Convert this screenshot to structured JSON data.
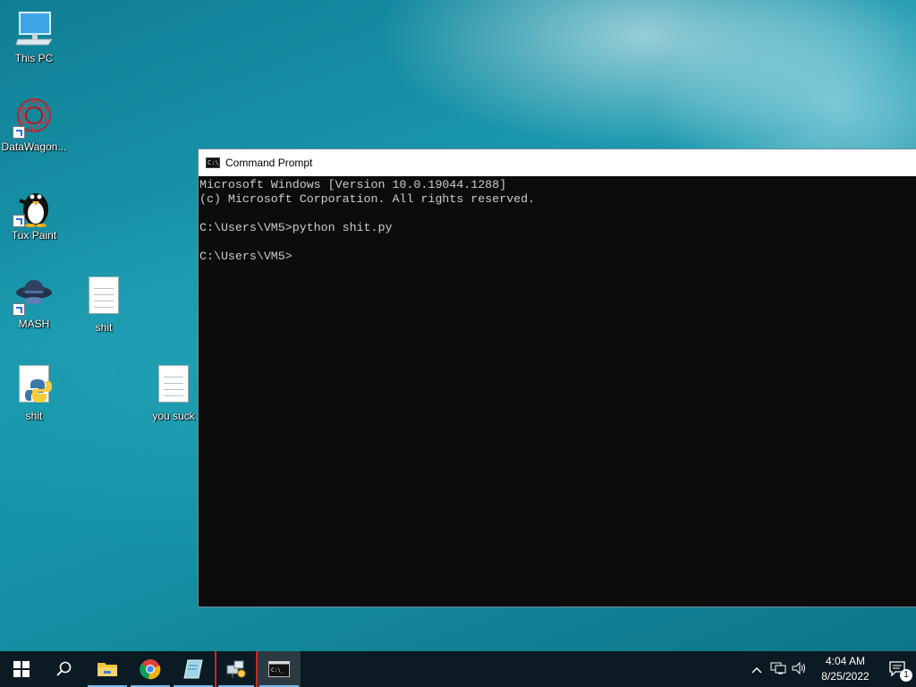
{
  "desktop": {
    "icons": [
      {
        "label": "This PC",
        "icon": "this-pc-icon"
      },
      {
        "label": "DataWagon...",
        "icon": "datawagon-icon"
      },
      {
        "label": "Tux Paint",
        "icon": "tux-paint-icon"
      },
      {
        "label": "MASH",
        "icon": "mash-icon"
      },
      {
        "label": "shit",
        "icon": "text-file-icon"
      },
      {
        "label": "shit",
        "icon": "python-file-icon"
      },
      {
        "label": "you suck",
        "icon": "text-file-icon"
      }
    ]
  },
  "window": {
    "title": "Command Prompt",
    "console_lines": [
      "Microsoft Windows [Version 10.0.19044.1288]",
      "(c) Microsoft Corporation. All rights reserved.",
      "",
      "C:\\Users\\VM5>python shit.py",
      "",
      "C:\\Users\\VM5>"
    ]
  },
  "taskbar": {
    "apps": [
      "start-icon",
      "search-icon",
      "file-explorer-icon",
      "chrome-icon",
      "notepad-icon",
      "network-app-icon",
      "command-prompt-icon"
    ],
    "clock": {
      "time": "4:04 AM",
      "date": "8/25/2022"
    },
    "notification_count": "1"
  }
}
